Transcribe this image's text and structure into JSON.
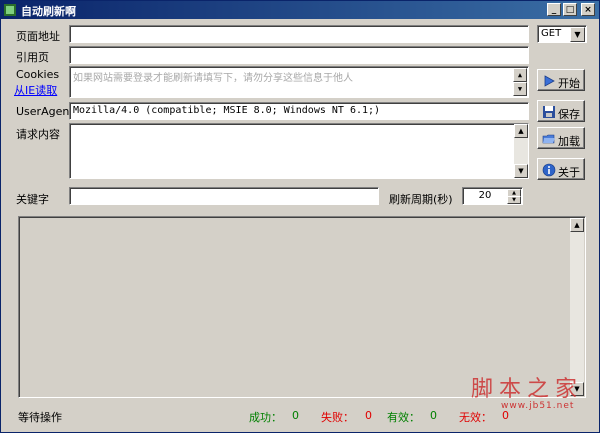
{
  "window": {
    "title": "自动刷新啊",
    "minimize": "_",
    "maximize": "□",
    "close": "×"
  },
  "form": {
    "page_url_label": "页面地址",
    "page_url_value": "",
    "method_value": "GET",
    "referer_label": "引用页",
    "referer_value": "",
    "cookies_label": "Cookies",
    "read_from_ie_link": "从IE读取",
    "cookies_hint": "如果网站需要登录才能刷新请填写下，请勿分享这些信息于他人",
    "useragent_label": "UserAgent",
    "useragent_value": "Mozilla/4.0 (compatible; MSIE 8.0; Windows NT 6.1;)",
    "request_body_label": "请求内容",
    "request_body_value": "",
    "keyword_label": "关键字",
    "keyword_value": "",
    "refresh_period_label": "刷新周期(秒)",
    "refresh_period_value": "20"
  },
  "buttons": {
    "start": "开始",
    "save": "保存",
    "load": "加载",
    "about": "关于"
  },
  "status": {
    "state": "等待操作",
    "success_label": "成功：",
    "success_value": "0",
    "fail_label": "失败：",
    "fail_value": "0",
    "valid_label": "有效：",
    "valid_value": "0",
    "invalid_label": "无效：",
    "invalid_value": "0"
  },
  "watermark": {
    "main": "脚本之家",
    "sub": "www.jb51.net"
  },
  "colors": {
    "title_start": "#0a246a",
    "title_end": "#3a6ea5",
    "status_green": "#008000",
    "status_red": "#e00000"
  }
}
